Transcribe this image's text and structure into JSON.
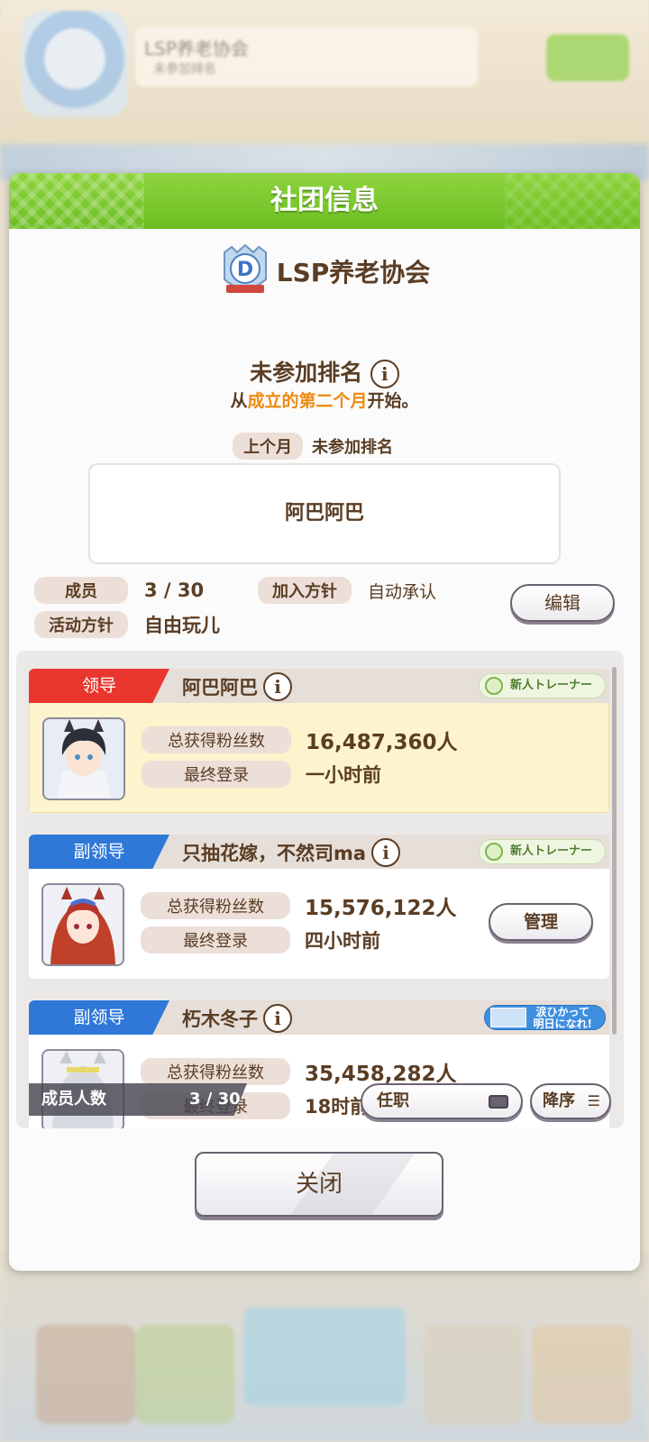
{
  "background": {
    "club_name": "LSP养老协会",
    "club_sub": "未参加排名"
  },
  "dialog": {
    "title": "社团信息",
    "club_name": "LSP养老协会",
    "rank_status": "未参加排名",
    "rank_start": {
      "prefix": "从",
      "highlight": "成立的第二个月",
      "suffix": "开始。"
    },
    "last_month_label": "上个月",
    "last_month_value": "未参加排名",
    "description": "阿巴阿巴",
    "members_label": "成员",
    "members_value": "3 / 30",
    "join_policy_label": "加入方针",
    "join_policy_value": "自动承认",
    "activity_label": "活动方针",
    "activity_value": "自由玩儿",
    "edit_button": "编辑",
    "close_button": "关闭"
  },
  "members": [
    {
      "role": "领导",
      "name": "阿巴阿巴",
      "title_badge": "新人トレーナー",
      "fans_label": "总获得粉丝数",
      "fans_value": "16,487,360人",
      "login_label": "最终登录",
      "login_value": "一小时前"
    },
    {
      "role": "副领导",
      "name": "只抽花嫁，不然司ma",
      "title_badge": "新人トレーナー",
      "fans_label": "总获得粉丝数",
      "fans_value": "15,576,122人",
      "login_label": "最终登录",
      "login_value": "四小时前",
      "manage_button": "管理"
    },
    {
      "role": "副领导",
      "name": "朽木冬子",
      "title_badge_line1": "涙ひかって",
      "title_badge_line2": "明日になれ!",
      "fans_label": "总获得粉丝数",
      "fans_value": "35,458,282人",
      "login_label": "最终登录",
      "login_value": "18时前"
    }
  ],
  "list_footer": {
    "count_label": "成员人数",
    "count_value": "3 / 30",
    "sort_key": "任职",
    "sort_order": "降序"
  },
  "colors": {
    "header_green": "#7ccb30",
    "leader_red": "#e9372f",
    "subleader_blue": "#2f78d8",
    "text_brown": "#5a3d24",
    "accent_orange": "#f08a10"
  }
}
